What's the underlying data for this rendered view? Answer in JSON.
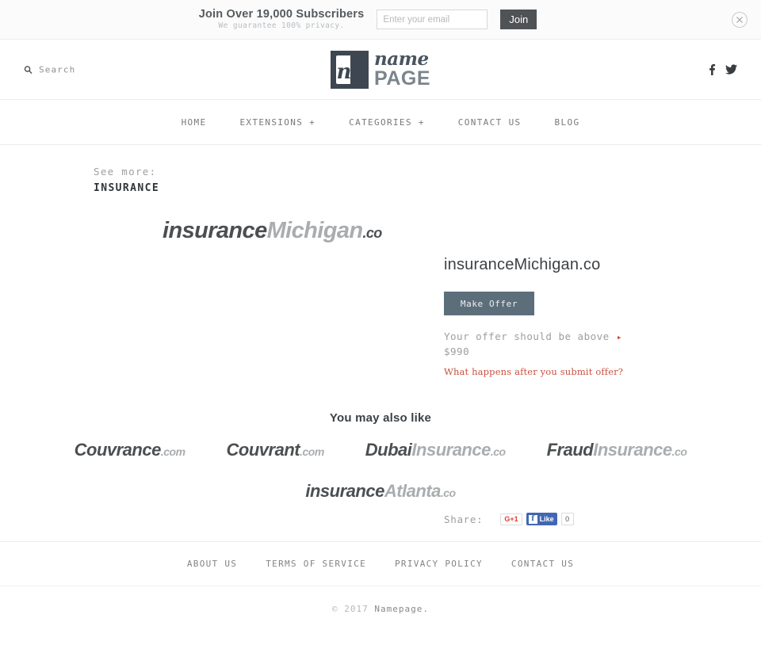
{
  "subscribe": {
    "title": "Join Over 19,000 Subscribers",
    "subtitle": "We guarantee 100% privacy.",
    "email_placeholder": "Enter your email",
    "email_value": "",
    "join_label": "Join",
    "close_icon": "close-circle-icon"
  },
  "header": {
    "search_label": "Search",
    "search_icon": "search-icon",
    "logo": {
      "mark_letter": "n",
      "name": "name",
      "page": "PAGE"
    },
    "social": [
      {
        "name": "facebook-icon",
        "label": "f"
      },
      {
        "name": "twitter-icon",
        "label": "t"
      }
    ]
  },
  "nav": {
    "items": [
      {
        "label": "HOME"
      },
      {
        "label": "EXTENSIONS +"
      },
      {
        "label": "CATEGORIES +"
      },
      {
        "label": "CONTACT US"
      },
      {
        "label": "BLOG"
      }
    ]
  },
  "see_more": {
    "label": "See more:",
    "category": "INSURANCE"
  },
  "hero": {
    "part_dark": "insurance",
    "part_light": "Michigan",
    "tld": ".co"
  },
  "offer": {
    "domain_title": "insuranceMichigan.co",
    "make_offer_label": "Make Offer",
    "note_line1": "Your offer should be above",
    "note_line2": "$990",
    "arrow_icon": "arrow-right-icon",
    "link_label": "What happens after you submit offer?",
    "share_label": "Share:",
    "gplus_label": "G+1",
    "fb_f": "f",
    "fb_like_label": "Like",
    "fb_count": "0"
  },
  "also_like": {
    "title": "You may also like",
    "row1": [
      {
        "dark": "Couvrance",
        "light": "",
        "tld": ".com"
      },
      {
        "dark": "Couvrant",
        "light": "",
        "tld": ".com"
      },
      {
        "dark": "Dubai",
        "light": "Insurance",
        "tld": ".co"
      },
      {
        "dark": "Fraud",
        "light": "Insurance",
        "tld": ".co"
      }
    ],
    "row2": [
      {
        "dark": "insurance",
        "light": "Atlanta",
        "tld": ".co"
      }
    ]
  },
  "footer": {
    "links": [
      {
        "label": "ABOUT US"
      },
      {
        "label": "TERMS OF SERVICE"
      },
      {
        "label": "PRIVACY POLICY"
      },
      {
        "label": "CONTACT US"
      }
    ],
    "copyright_prefix": "© 2017 ",
    "copyright_name": "Namepage."
  },
  "colors": {
    "accent_red": "#c9503f",
    "button_slate": "#5d6e7b",
    "join_dark": "#4f5356",
    "fb_blue": "#4267b2",
    "gplus_red": "#d94235"
  }
}
